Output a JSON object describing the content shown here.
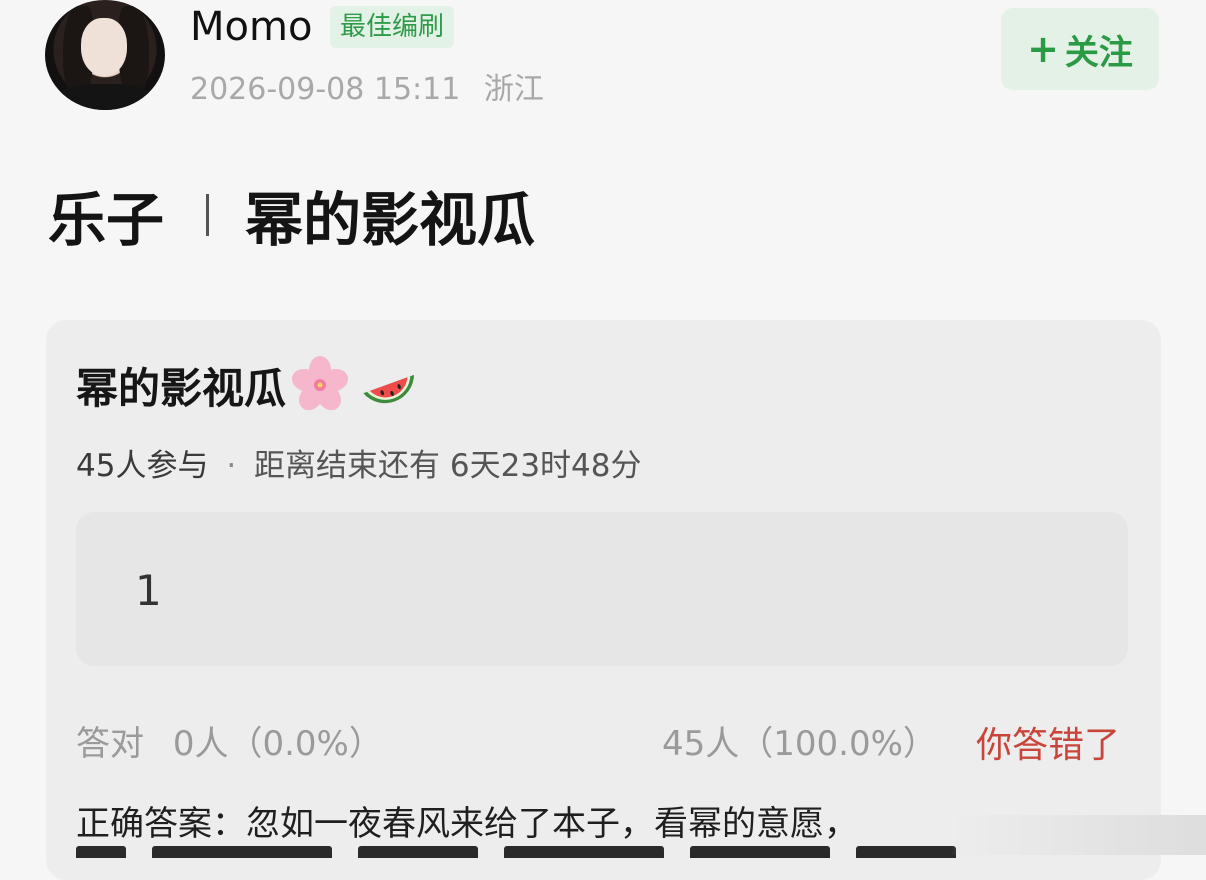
{
  "post": {
    "username": "Momo",
    "badge": "最佳编刷",
    "datetime": "2026-09-08 15:11",
    "location": "浙江",
    "follow_label": "关注",
    "follow_plus": "+",
    "headline_left": "乐子",
    "headline_right": "幂的影视瓜"
  },
  "quiz": {
    "title": "幂的影视瓜",
    "title_emojis": [
      "cherry-blossom-icon",
      "watermelon-icon"
    ],
    "participants": "45人参与",
    "dot": "·",
    "time_left": "距离结束还有 6天23时48分",
    "option_text": "1",
    "correct_label": "答对",
    "correct_stat": "0人（0.0%）",
    "other_stat": "45人（100.0%）",
    "result": "你答错了",
    "answer_text": "正确答案：忽如一夜春风来给了本子，看幂的意愿，"
  },
  "colors": {
    "accent_green": "#2b9a45",
    "wrong_red": "#c9453c",
    "badge_bg": "#e3f2e6"
  }
}
